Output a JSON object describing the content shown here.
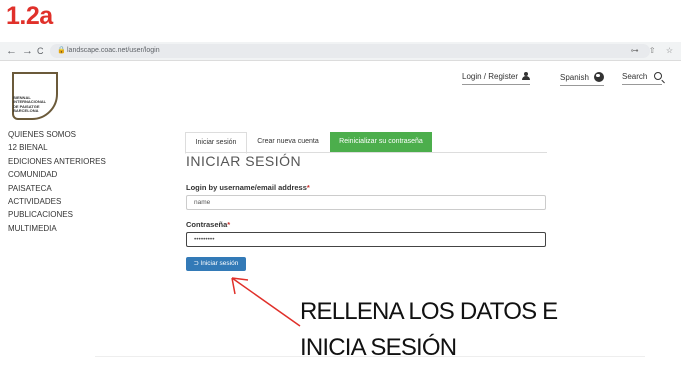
{
  "step_label": "1.2a",
  "browser": {
    "url": "landscape.coac.net/user/login",
    "back": "←",
    "forward": "→",
    "reload": "C",
    "lock": "🔒",
    "right_icons": "⊶ ⇧ ☆"
  },
  "logo": {
    "lines": [
      "BIENNAL",
      "INTERNACIONAL",
      "DE PAISATGE",
      "BARCELONA"
    ]
  },
  "header": {
    "login_register": "Login  /  Register",
    "language": "Spanish",
    "search": "Search"
  },
  "sidebar": {
    "items": [
      {
        "label": "QUIENES SOMOS"
      },
      {
        "label": "12 BIENAL"
      },
      {
        "label": "EDICIONES ANTERIORES"
      },
      {
        "label": "COMUNIDAD"
      },
      {
        "label": "PAISATECA"
      },
      {
        "label": "ACTIVIDADES"
      },
      {
        "label": "PUBLICACIONES"
      },
      {
        "label": "MULTIMEDIA"
      }
    ]
  },
  "tabs": [
    {
      "label": "Iniciar sesión"
    },
    {
      "label": "Crear nueva cuenta"
    },
    {
      "label": "Reinicializar su contraseña"
    }
  ],
  "form": {
    "title": "INICIAR SESIÓN",
    "username_label": "Login by username/email address",
    "username_value": "name",
    "password_label": "Contraseña",
    "password_value": "•••••••••",
    "required_mark": "*",
    "submit_icon": "⮊",
    "submit_label": "Iniciar sesión"
  },
  "annotation": {
    "line1": "RELLENA LOS DATOS E",
    "line2": "INICIA SESIÓN",
    "color": "#e0302a"
  },
  "colors": {
    "accent_red": "#e0302a",
    "tab_green": "#4cae4c",
    "button_blue": "#337ab7"
  }
}
